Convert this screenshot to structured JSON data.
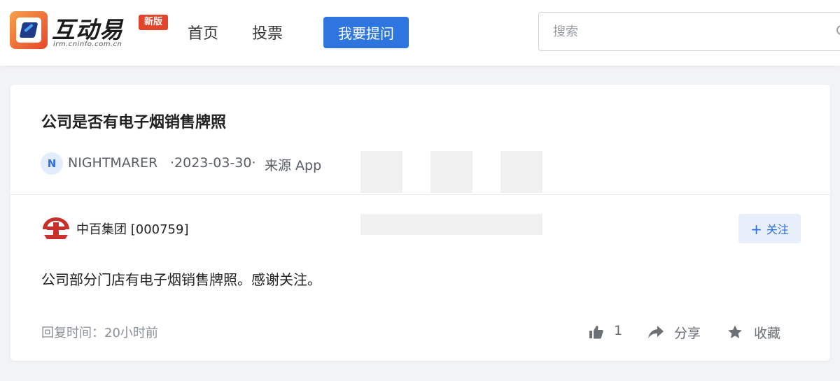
{
  "header": {
    "logo_text": "互动易",
    "logo_sub": "irm.cninfo.com.cn",
    "logo_badge": "新版",
    "nav": [
      {
        "label": "首页"
      },
      {
        "label": "投票"
      }
    ],
    "ask_button": "我要提问",
    "search_placeholder": "搜索"
  },
  "question": {
    "title": "公司是否有电子烟销售牌照",
    "avatar_letter": "N",
    "user": "NIGHTMARER",
    "date": "·2023-03-30·",
    "source": "来源 App"
  },
  "reply": {
    "company": "中百集团 [000759]",
    "follow_label": "关注",
    "answer": "公司部分门店有电子烟销售牌照。感谢关注。",
    "reply_time": "回复时间：20小时前",
    "likes": "1",
    "share_label": "分享",
    "favorite_label": "收藏"
  },
  "colors": {
    "accent": "#2f75e0",
    "badge": "#e4432c",
    "company_logo": "#c8312b",
    "background": "#f2f3f5"
  },
  "icons": [
    "search-icon",
    "thumbs-up-icon",
    "share-arrow-icon",
    "star-icon",
    "plus-icon"
  ]
}
